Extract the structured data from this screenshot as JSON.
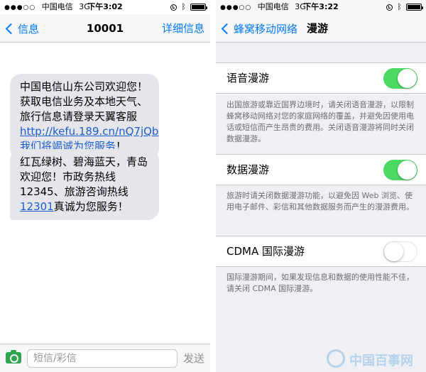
{
  "left": {
    "status": {
      "carrier": "中国电信",
      "network": "3G",
      "time": "下午3:02"
    },
    "nav": {
      "back_label": "信息",
      "title": "10001",
      "action_label": "详细信息"
    },
    "messages": [
      {
        "text_before": "中国电信山东公司欢迎您！获取电信业务及本地天气、旅行信息请登录天翼客服",
        "link": "http://kefu.189.cn/nQ7jQb我们将竭诚为您服务",
        "text_after": "！"
      },
      {
        "text_before": "红瓦绿树、碧海蓝天，青岛欢迎您！市政务热线12345、旅游咨询热线",
        "link": "12301",
        "text_after": "真诚为您服务！"
      }
    ],
    "input": {
      "placeholder": "短信/彩信",
      "send_label": "发送"
    }
  },
  "right": {
    "status": {
      "carrier": "中国电信",
      "network": "3G",
      "time": "下午3:22"
    },
    "nav": {
      "back_label": "蜂窝移动网络",
      "title": "漫游"
    },
    "settings": [
      {
        "label": "语音漫游",
        "on": true,
        "footer": "出国旅游或靠近国界边境时，请关闭语音漫游，以限制蜂窝移动网络对您的家庭网络的覆盖，并避免因使用电话或短信而产生昂贵的费用。关闭语音漫游将同时关闭数据漫游。"
      },
      {
        "label": "数据漫游",
        "on": true,
        "footer": "旅游时请关闭数据漫游功能，以避免因 Web 浏览、使用电子邮件、彩信和其他数据服务而产生的漫游费用。"
      },
      {
        "label": "CDMA 国际漫游",
        "on": false,
        "footer": "国际漫游期间，如果发现信息和数据的使用性能不佳，请关闭 CDMA 国际漫游。"
      }
    ],
    "watermark": "中国百事网"
  },
  "colors": {
    "accent": "#007aff",
    "toggle_on": "#4cd964",
    "bubble": "#e5e5ea",
    "grouped_bg": "#efeff4"
  },
  "icons": [
    "signal-dots-icon",
    "lock-rotation-icon",
    "bluetooth-icon",
    "battery-icon",
    "chevron-left-icon",
    "camera-icon"
  ]
}
